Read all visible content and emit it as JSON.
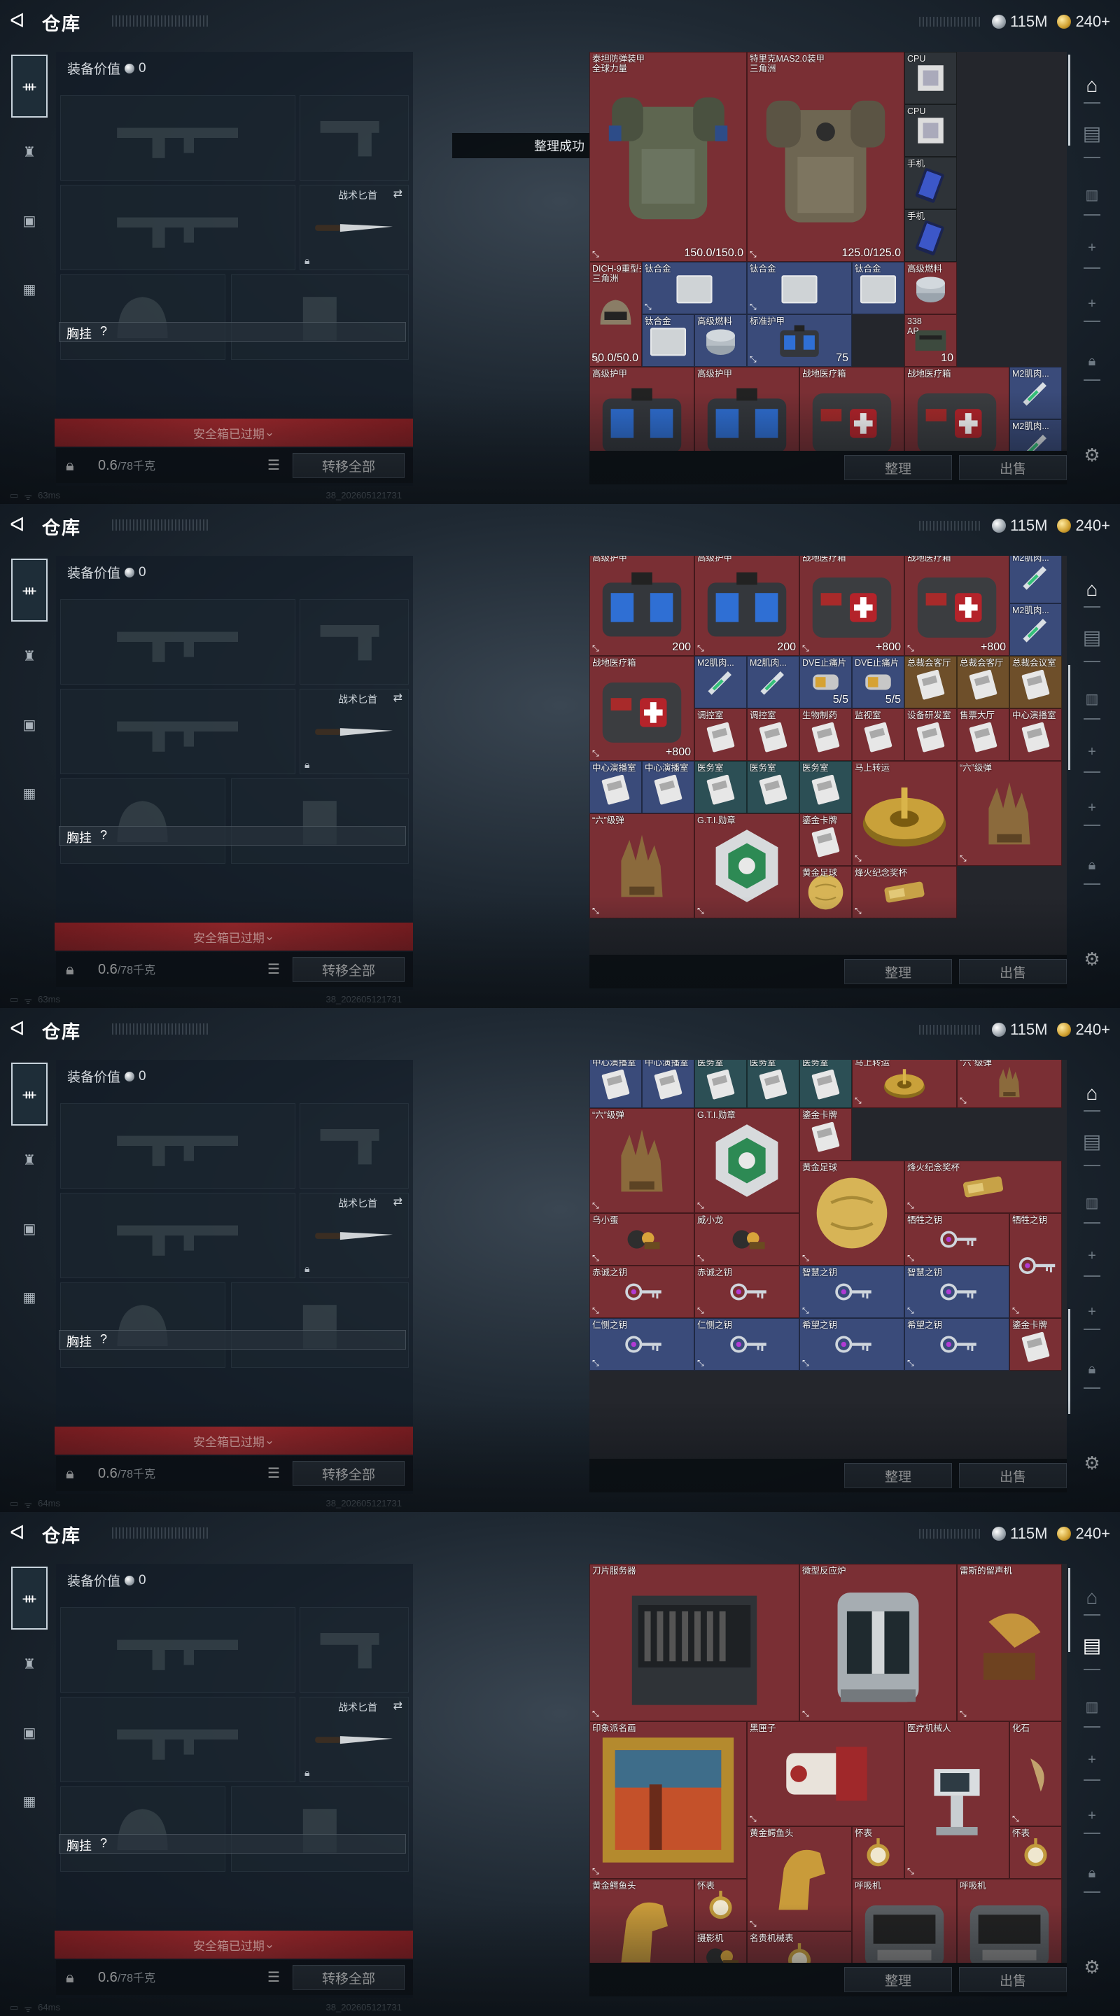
{
  "screens": [
    {
      "toast": "整理成功",
      "status": {
        "ping": "63ms"
      }
    },
    {
      "toast": "",
      "status": {
        "ping": "63ms"
      }
    },
    {
      "toast": "",
      "status": {
        "ping": "64ms"
      }
    },
    {
      "toast": "",
      "status": {
        "ping": "64ms"
      }
    }
  ],
  "header": {
    "title": "仓库",
    "currency_silver": "115M",
    "currency_gold": "240+"
  },
  "equip": {
    "value_label": "装备价值",
    "value": "0",
    "knife_label": "战术匕首",
    "vest_label": "胸挂",
    "vest_value": "?",
    "safe_box_expired": "安全箱已过期",
    "weight": "0.6",
    "weight_max": "/78千克",
    "transfer_all": "转移全部"
  },
  "buttons": {
    "sort": "整理",
    "sell": "出售"
  },
  "status": {
    "build": "38_202605121731"
  },
  "grid": {
    "s1": [
      {
        "name": "泰坦防弹装甲\n全球力量",
        "value": "150.0/150.0",
        "c": "",
        "x": 0,
        "y": 0,
        "w": 3,
        "h": 4,
        "icon": "armor"
      },
      {
        "name": "特里克MAS2.0装甲\n三角洲",
        "value": "125.0/125.0",
        "c": "",
        "x": 3,
        "y": 0,
        "w": 3,
        "h": 4,
        "icon": "armor2"
      },
      {
        "name": "CPU",
        "value": "",
        "c": "c-dark",
        "x": 6,
        "y": 0,
        "w": 1,
        "h": 1,
        "icon": "cpu"
      },
      {
        "name": "CPU",
        "value": "",
        "c": "c-dark",
        "x": 6,
        "y": 1,
        "w": 1,
        "h": 1,
        "icon": "cpu"
      },
      {
        "name": "手机",
        "value": "",
        "c": "c-dark",
        "x": 6,
        "y": 2,
        "w": 1,
        "h": 1,
        "icon": "phone"
      },
      {
        "name": "手机",
        "value": "",
        "c": "c-dark",
        "x": 6,
        "y": 3,
        "w": 1,
        "h": 1,
        "icon": "phone"
      },
      {
        "name": "DICH-9重型头盔\n三角洲",
        "value": "50.0/50.0",
        "c": "",
        "x": 0,
        "y": 4,
        "w": 1,
        "h": 2,
        "icon": "helmet"
      },
      {
        "name": "钛合金",
        "value": "",
        "c": "c-blue",
        "x": 1,
        "y": 4,
        "w": 2,
        "h": 1,
        "icon": "plate"
      },
      {
        "name": "钛合金",
        "value": "",
        "c": "c-blue",
        "x": 3,
        "y": 4,
        "w": 2,
        "h": 1,
        "icon": "plate"
      },
      {
        "name": "钛合金",
        "value": "",
        "c": "c-blue",
        "x": 5,
        "y": 4,
        "w": 1,
        "h": 1,
        "icon": "plate"
      },
      {
        "name": "高级燃料",
        "value": "",
        "c": "",
        "x": 6,
        "y": 4,
        "w": 1,
        "h": 1,
        "icon": "fuel"
      },
      {
        "name": "钛合金",
        "value": "",
        "c": "c-blue",
        "x": 1,
        "y": 5,
        "w": 1,
        "h": 1,
        "icon": "plate"
      },
      {
        "name": "高级燃料",
        "value": "",
        "c": "c-blue",
        "x": 2,
        "y": 5,
        "w": 1,
        "h": 1,
        "icon": "fuel"
      },
      {
        "name": "标准护甲",
        "value": "75",
        "c": "c-blue",
        "x": 3,
        "y": 5,
        "w": 2,
        "h": 1,
        "icon": "bag"
      },
      {
        "name": "338\nAP",
        "value": "10",
        "c": "",
        "x": 6,
        "y": 5,
        "w": 1,
        "h": 1,
        "icon": "ammo"
      },
      {
        "name": "高级护甲",
        "value": "",
        "c": "",
        "x": 0,
        "y": 6,
        "w": 2,
        "h": 2,
        "icon": "bag"
      },
      {
        "name": "高级护甲",
        "value": "",
        "c": "",
        "x": 2,
        "y": 6,
        "w": 2,
        "h": 2,
        "icon": "bag"
      },
      {
        "name": "战地医疗箱",
        "value": "",
        "c": "",
        "x": 4,
        "y": 6,
        "w": 2,
        "h": 2,
        "icon": "med"
      },
      {
        "name": "战地医疗箱",
        "value": "",
        "c": "",
        "x": 6,
        "y": 6,
        "w": 2,
        "h": 2,
        "icon": "med"
      },
      {
        "name": "M2肌肉...",
        "value": "",
        "c": "c-blue",
        "x": 8,
        "y": 6,
        "w": 1,
        "h": 1,
        "icon": "syringe"
      },
      {
        "name": "M2肌肉...",
        "value": "",
        "c": "c-blue",
        "x": 8,
        "y": 7,
        "w": 1,
        "h": 1,
        "icon": "syringe"
      }
    ],
    "s2": [
      {
        "name": "",
        "value": "50.0/50.0",
        "c": "",
        "x": 0,
        "y": 0,
        "w": 1,
        "h": 1,
        "icon": "helmet"
      },
      {
        "name": "钛合金",
        "value": "",
        "c": "c-blue",
        "x": 1,
        "y": 0,
        "w": 1,
        "h": 1,
        "icon": "plate"
      },
      {
        "name": "高级燃料",
        "value": "",
        "c": "c-blue",
        "x": 2,
        "y": 0,
        "w": 1,
        "h": 1,
        "icon": "fuel"
      },
      {
        "name": "标准护甲",
        "value": "75",
        "c": "c-blue",
        "x": 3,
        "y": 0,
        "w": 2,
        "h": 1,
        "icon": "bag"
      },
      {
        "name": "338\nAP",
        "value": "10",
        "c": "",
        "x": 6,
        "y": 0,
        "w": 1,
        "h": 1,
        "icon": "ammo"
      },
      {
        "name": "高级护甲",
        "value": "200",
        "c": "",
        "x": 0,
        "y": 1,
        "w": 2,
        "h": 2,
        "icon": "bag"
      },
      {
        "name": "高级护甲",
        "value": "200",
        "c": "",
        "x": 2,
        "y": 1,
        "w": 2,
        "h": 2,
        "icon": "bag"
      },
      {
        "name": "战地医疗箱",
        "value": "+800",
        "c": "",
        "x": 4,
        "y": 1,
        "w": 2,
        "h": 2,
        "icon": "med"
      },
      {
        "name": "战地医疗箱",
        "value": "+800",
        "c": "",
        "x": 6,
        "y": 1,
        "w": 2,
        "h": 2,
        "icon": "med"
      },
      {
        "name": "M2肌肉...",
        "value": "",
        "c": "c-blue",
        "x": 8,
        "y": 1,
        "w": 1,
        "h": 1,
        "icon": "syringe"
      },
      {
        "name": "M2肌肉...",
        "value": "",
        "c": "c-blue",
        "x": 8,
        "y": 2,
        "w": 1,
        "h": 1,
        "icon": "syringe"
      },
      {
        "name": "战地医疗箱",
        "value": "+800",
        "c": "",
        "x": 0,
        "y": 3,
        "w": 2,
        "h": 2,
        "icon": "med"
      },
      {
        "name": "M2肌肉...",
        "value": "",
        "c": "c-blue",
        "x": 2,
        "y": 3,
        "w": 1,
        "h": 1,
        "icon": "syringe"
      },
      {
        "name": "M2肌肉...",
        "value": "",
        "c": "c-blue",
        "x": 3,
        "y": 3,
        "w": 1,
        "h": 1,
        "icon": "syringe"
      },
      {
        "name": "DVE止痛片",
        "value": "5/5",
        "c": "c-blue",
        "x": 4,
        "y": 3,
        "w": 1,
        "h": 1,
        "icon": "pill"
      },
      {
        "name": "DVE止痛片",
        "value": "5/5",
        "c": "c-blue",
        "x": 5,
        "y": 3,
        "w": 1,
        "h": 1,
        "icon": "pill"
      },
      {
        "name": "总裁会客厅",
        "value": "",
        "c": "c-gold",
        "x": 6,
        "y": 3,
        "w": 1,
        "h": 1,
        "icon": "card"
      },
      {
        "name": "总裁会客厅",
        "value": "",
        "c": "c-gold",
        "x": 7,
        "y": 3,
        "w": 1,
        "h": 1,
        "icon": "card"
      },
      {
        "name": "总裁会议室",
        "value": "",
        "c": "c-gold",
        "x": 8,
        "y": 3,
        "w": 1,
        "h": 1,
        "icon": "card"
      },
      {
        "name": "调控室",
        "value": "",
        "c": "",
        "x": 2,
        "y": 4,
        "w": 1,
        "h": 1,
        "icon": "card"
      },
      {
        "name": "调控室",
        "value": "",
        "c": "",
        "x": 3,
        "y": 4,
        "w": 1,
        "h": 1,
        "icon": "card"
      },
      {
        "name": "生物制药",
        "value": "",
        "c": "",
        "x": 4,
        "y": 4,
        "w": 1,
        "h": 1,
        "icon": "card"
      },
      {
        "name": "监视室",
        "value": "",
        "c": "",
        "x": 5,
        "y": 4,
        "w": 1,
        "h": 1,
        "icon": "card"
      },
      {
        "name": "设备研发室",
        "value": "",
        "c": "",
        "x": 6,
        "y": 4,
        "w": 1,
        "h": 1,
        "icon": "card"
      },
      {
        "name": "售票大厅",
        "value": "",
        "c": "",
        "x": 7,
        "y": 4,
        "w": 1,
        "h": 1,
        "icon": "card"
      },
      {
        "name": "中心演播室",
        "value": "",
        "c": "",
        "x": 8,
        "y": 4,
        "w": 1,
        "h": 1,
        "icon": "card"
      },
      {
        "name": "中心演播室",
        "value": "",
        "c": "c-blue",
        "x": 0,
        "y": 5,
        "w": 1,
        "h": 1,
        "icon": "card"
      },
      {
        "name": "中心演播室",
        "value": "",
        "c": "c-blue",
        "x": 1,
        "y": 5,
        "w": 1,
        "h": 1,
        "icon": "card"
      },
      {
        "name": "医务室",
        "value": "",
        "c": "c-green",
        "x": 2,
        "y": 5,
        "w": 1,
        "h": 1,
        "icon": "card"
      },
      {
        "name": "医务室",
        "value": "",
        "c": "c-green",
        "x": 3,
        "y": 5,
        "w": 1,
        "h": 1,
        "icon": "card"
      },
      {
        "name": "医务室",
        "value": "",
        "c": "c-green",
        "x": 4,
        "y": 5,
        "w": 1,
        "h": 1,
        "icon": "card"
      },
      {
        "name": "马上转运",
        "value": "",
        "c": "",
        "x": 5,
        "y": 5,
        "w": 2,
        "h": 2,
        "icon": "disc"
      },
      {
        "name": "“六”级弹",
        "value": "",
        "c": "",
        "x": 7,
        "y": 5,
        "w": 2,
        "h": 2,
        "icon": "hand"
      },
      {
        "name": "“六”级弹",
        "value": "",
        "c": "",
        "x": 0,
        "y": 6,
        "w": 2,
        "h": 2,
        "icon": "hand"
      },
      {
        "name": "G.T.I.勋章",
        "value": "",
        "c": "",
        "x": 2,
        "y": 6,
        "w": 2,
        "h": 2,
        "icon": "medal"
      },
      {
        "name": "鎏金卡牌",
        "value": "",
        "c": "",
        "x": 4,
        "y": 6,
        "w": 1,
        "h": 1,
        "icon": "card"
      },
      {
        "name": "黄金足球",
        "value": "",
        "c": "",
        "x": 4,
        "y": 7,
        "w": 1,
        "h": 1,
        "icon": "ball"
      },
      {
        "name": "烽火纪念奖杯",
        "value": "",
        "c": "",
        "x": 5,
        "y": 7,
        "w": 2,
        "h": 1,
        "icon": "trophy"
      }
    ],
    "s3": [
      {
        "name": "中心演播室",
        "value": "",
        "c": "c-blue",
        "x": 0,
        "y": 0,
        "w": 1,
        "h": 1,
        "icon": "card"
      },
      {
        "name": "中心演播室",
        "value": "",
        "c": "c-blue",
        "x": 1,
        "y": 0,
        "w": 1,
        "h": 1,
        "icon": "card"
      },
      {
        "name": "医务室",
        "value": "",
        "c": "c-green",
        "x": 2,
        "y": 0,
        "w": 1,
        "h": 1,
        "icon": "card"
      },
      {
        "name": "医务室",
        "value": "",
        "c": "c-green",
        "x": 3,
        "y": 0,
        "w": 1,
        "h": 1,
        "icon": "card"
      },
      {
        "name": "医务室",
        "value": "",
        "c": "c-green",
        "x": 4,
        "y": 0,
        "w": 1,
        "h": 1,
        "icon": "card"
      },
      {
        "name": "马上转运",
        "value": "",
        "c": "",
        "x": 5,
        "y": 0,
        "w": 2,
        "h": 1,
        "icon": "disc"
      },
      {
        "name": "“六”级弹",
        "value": "",
        "c": "",
        "x": 7,
        "y": 0,
        "w": 2,
        "h": 1,
        "icon": "hand"
      },
      {
        "name": "“六”级弹",
        "value": "",
        "c": "",
        "x": 0,
        "y": 1,
        "w": 2,
        "h": 2,
        "icon": "hand"
      },
      {
        "name": "G.T.I.勋章",
        "value": "",
        "c": "",
        "x": 2,
        "y": 1,
        "w": 2,
        "h": 2,
        "icon": "medal"
      },
      {
        "name": "鎏金卡牌",
        "value": "",
        "c": "",
        "x": 4,
        "y": 1,
        "w": 1,
        "h": 1,
        "icon": "card"
      },
      {
        "name": "黄金足球",
        "value": "",
        "c": "",
        "x": 4,
        "y": 2,
        "w": 2,
        "h": 2,
        "icon": "ball"
      },
      {
        "name": "烽火纪念奖杯",
        "value": "",
        "c": "",
        "x": 6,
        "y": 2,
        "w": 3,
        "h": 1,
        "icon": "trophy"
      },
      {
        "name": "乌小蛋",
        "value": "",
        "c": "",
        "x": 0,
        "y": 3,
        "w": 2,
        "h": 1,
        "icon": "toy"
      },
      {
        "name": "威小龙",
        "value": "",
        "c": "",
        "x": 2,
        "y": 3,
        "w": 2,
        "h": 1,
        "icon": "toy"
      },
      {
        "name": "牺牲之钥",
        "value": "",
        "c": "",
        "x": 6,
        "y": 3,
        "w": 2,
        "h": 1,
        "icon": "key"
      },
      {
        "name": "牺牲之钥",
        "value": "",
        "c": "",
        "x": 8,
        "y": 3,
        "w": 1,
        "h": 2,
        "icon": "key"
      },
      {
        "name": "赤诚之钥",
        "value": "",
        "c": "",
        "x": 0,
        "y": 4,
        "w": 2,
        "h": 1,
        "icon": "key"
      },
      {
        "name": "赤诚之钥",
        "value": "",
        "c": "",
        "x": 2,
        "y": 4,
        "w": 2,
        "h": 1,
        "icon": "key"
      },
      {
        "name": "智慧之钥",
        "value": "",
        "c": "c-blue",
        "x": 4,
        "y": 4,
        "w": 2,
        "h": 1,
        "icon": "key"
      },
      {
        "name": "智慧之钥",
        "value": "",
        "c": "c-blue",
        "x": 6,
        "y": 4,
        "w": 2,
        "h": 1,
        "icon": "key"
      },
      {
        "name": "仁恻之钥",
        "value": "",
        "c": "c-blue",
        "x": 0,
        "y": 5,
        "w": 2,
        "h": 1,
        "icon": "key"
      },
      {
        "name": "仁恻之钥",
        "value": "",
        "c": "c-blue",
        "x": 2,
        "y": 5,
        "w": 2,
        "h": 1,
        "icon": "key"
      },
      {
        "name": "希望之钥",
        "value": "",
        "c": "c-blue",
        "x": 4,
        "y": 5,
        "w": 2,
        "h": 1,
        "icon": "key"
      },
      {
        "name": "希望之钥",
        "value": "",
        "c": "c-blue",
        "x": 6,
        "y": 5,
        "w": 2,
        "h": 1,
        "icon": "key"
      },
      {
        "name": "鎏金卡牌",
        "value": "",
        "c": "",
        "x": 8,
        "y": 5,
        "w": 1,
        "h": 1,
        "icon": "card"
      }
    ],
    "s4": [
      {
        "name": "刀片服务器",
        "value": "",
        "c": "",
        "x": 0,
        "y": 0,
        "w": 4,
        "h": 3,
        "icon": "server"
      },
      {
        "name": "微型反应炉",
        "value": "",
        "c": "",
        "x": 4,
        "y": 0,
        "w": 3,
        "h": 3,
        "icon": "reactor"
      },
      {
        "name": "雷斯的留声机",
        "value": "",
        "c": "",
        "x": 7,
        "y": 0,
        "w": 2,
        "h": 3,
        "icon": "phono"
      },
      {
        "name": "印象派名画",
        "value": "",
        "c": "",
        "x": 0,
        "y": 3,
        "w": 3,
        "h": 3,
        "icon": "painting"
      },
      {
        "name": "黑匣子",
        "value": "",
        "c": "",
        "x": 3,
        "y": 3,
        "w": 3,
        "h": 2,
        "icon": "blackbox"
      },
      {
        "name": "医疗机械人",
        "value": "",
        "c": "",
        "x": 6,
        "y": 3,
        "w": 2,
        "h": 3,
        "icon": "robot"
      },
      {
        "name": "化石",
        "value": "",
        "c": "",
        "x": 8,
        "y": 3,
        "w": 1,
        "h": 2,
        "icon": "fossil"
      },
      {
        "name": "黄金鳄鱼头",
        "value": "",
        "c": "",
        "x": 3,
        "y": 5,
        "w": 2,
        "h": 2,
        "icon": "horse"
      },
      {
        "name": "怀表",
        "value": "",
        "c": "",
        "x": 5,
        "y": 5,
        "w": 1,
        "h": 1,
        "icon": "watch"
      },
      {
        "name": "怀表",
        "value": "",
        "c": "",
        "x": 8,
        "y": 5,
        "w": 1,
        "h": 1,
        "icon": "watch"
      },
      {
        "name": "黄金鳄鱼头",
        "value": "",
        "c": "",
        "x": 0,
        "y": 6,
        "w": 2,
        "h": 2,
        "icon": "horse"
      },
      {
        "name": "怀表",
        "value": "",
        "c": "",
        "x": 2,
        "y": 6,
        "w": 1,
        "h": 1,
        "icon": "watch"
      },
      {
        "name": "呼吸机",
        "value": "",
        "c": "",
        "x": 5,
        "y": 6,
        "w": 2,
        "h": 2,
        "icon": "vent"
      },
      {
        "name": "呼吸机",
        "value": "",
        "c": "",
        "x": 7,
        "y": 6,
        "w": 2,
        "h": 2,
        "icon": "vent"
      },
      {
        "name": "摄影机",
        "value": "",
        "c": "",
        "x": 2,
        "y": 7,
        "w": 1,
        "h": 1,
        "icon": "toy"
      },
      {
        "name": "名贵机械表",
        "value": "",
        "c": "",
        "x": 3,
        "y": 7,
        "w": 2,
        "h": 1,
        "icon": "watch"
      }
    ]
  },
  "colors": {
    "accent_red": "#a72a2e",
    "cell_red": "#7a2f34",
    "cell_blue": "#3a4b7a"
  }
}
